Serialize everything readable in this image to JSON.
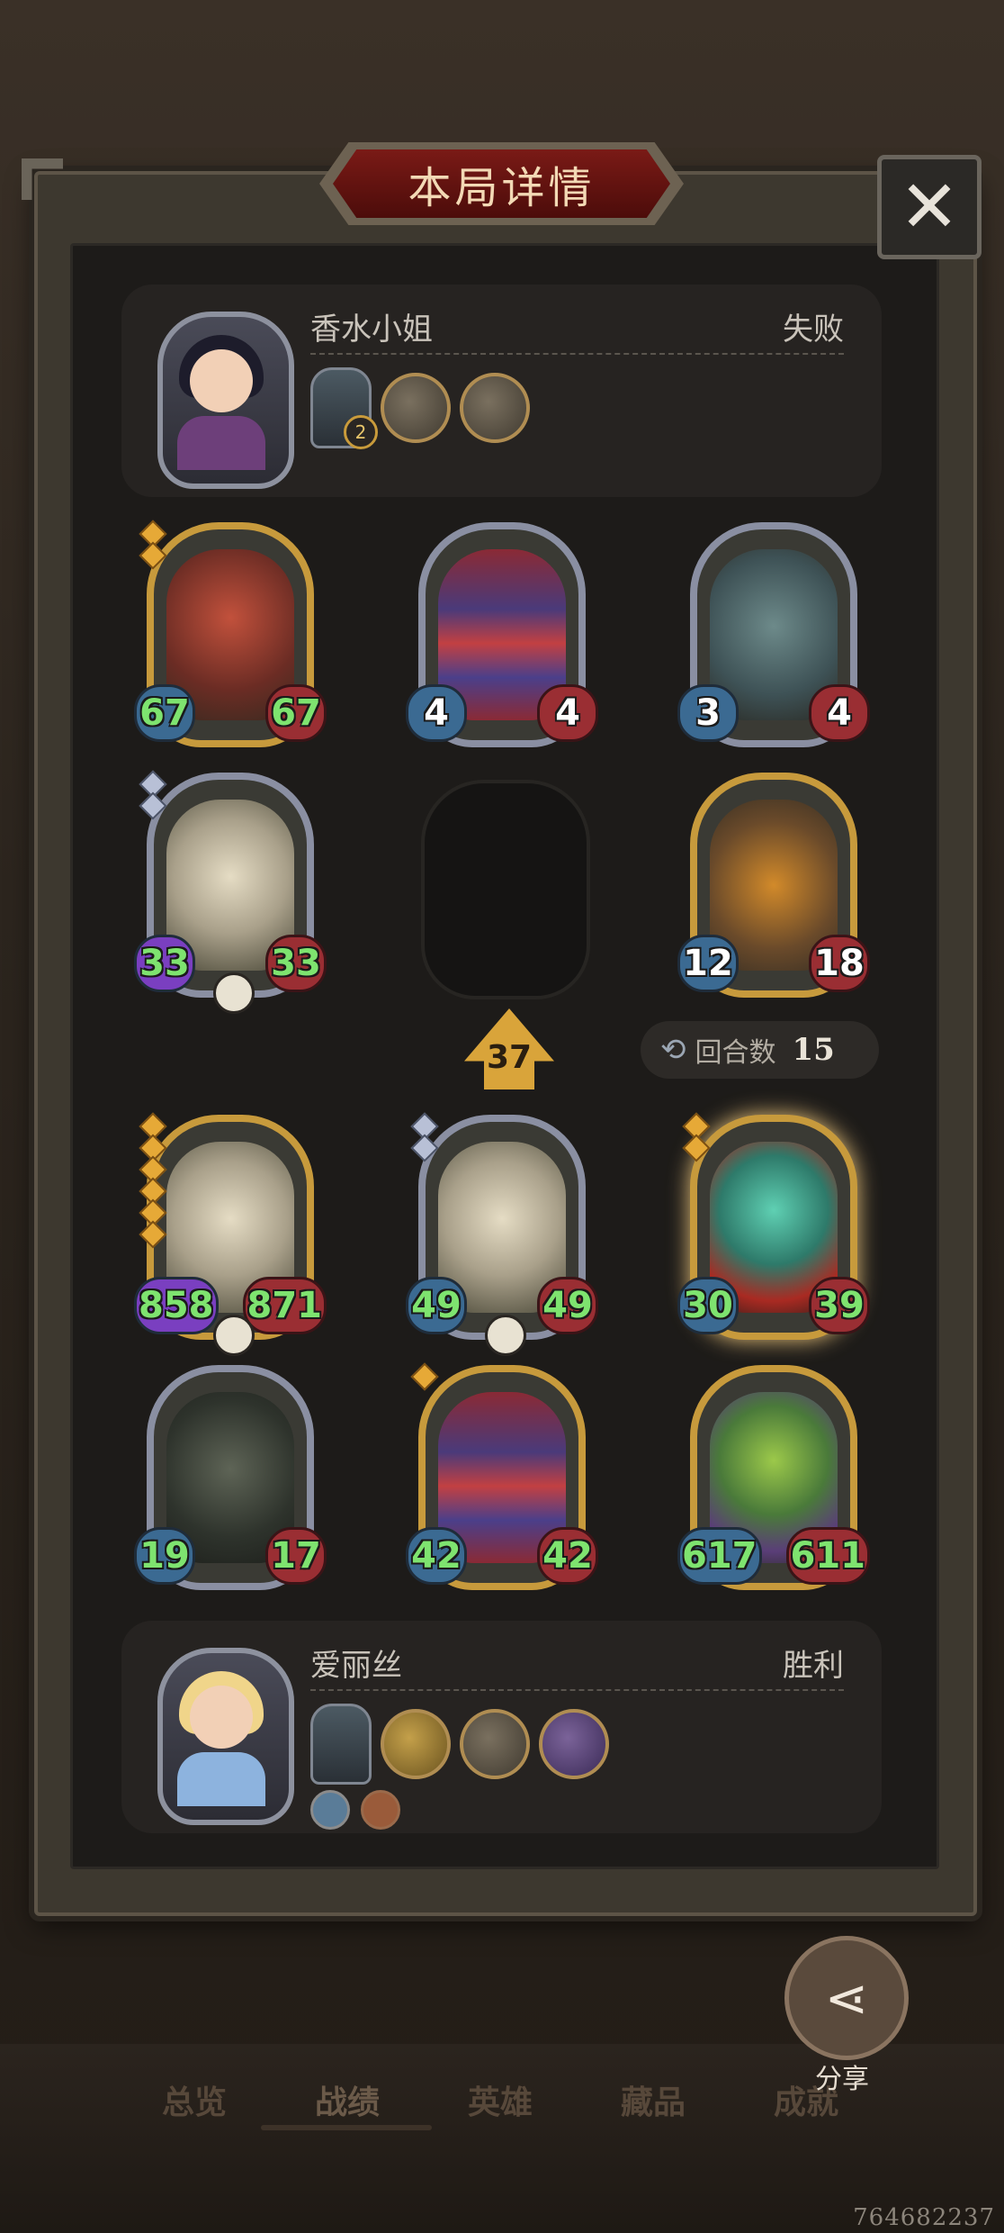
{
  "title": "本局详情",
  "close_label": "✕",
  "top_player": {
    "name": "香水小姐",
    "result": "失败",
    "hero_level": "2"
  },
  "bottom_player": {
    "name": "爱丽丝",
    "result": "胜利"
  },
  "opponent_board": [
    {
      "atk": "67",
      "hp": "67"
    },
    {
      "atk": "4",
      "hp": "4"
    },
    {
      "atk": "3",
      "hp": "4"
    },
    {
      "atk": "33",
      "hp": "33"
    },
    {
      "atk": "12",
      "hp": "18"
    }
  ],
  "tier": "37",
  "rounds": {
    "label": "回合数",
    "value": "15"
  },
  "player_board": [
    {
      "atk": "858",
      "hp": "871"
    },
    {
      "atk": "49",
      "hp": "49"
    },
    {
      "atk": "30",
      "hp": "39"
    },
    {
      "atk": "19",
      "hp": "17"
    },
    {
      "atk": "42",
      "hp": "42"
    },
    {
      "atk": "617",
      "hp": "611"
    }
  ],
  "share_label": "分享",
  "nav": [
    "总览",
    "战绩",
    "英雄",
    "藏品",
    "成就"
  ],
  "uid": "764682237",
  "colors": {
    "atk_text": "#7ee36f",
    "title_bg": "#7a1a16",
    "gold_frame": "#c79a3c"
  }
}
